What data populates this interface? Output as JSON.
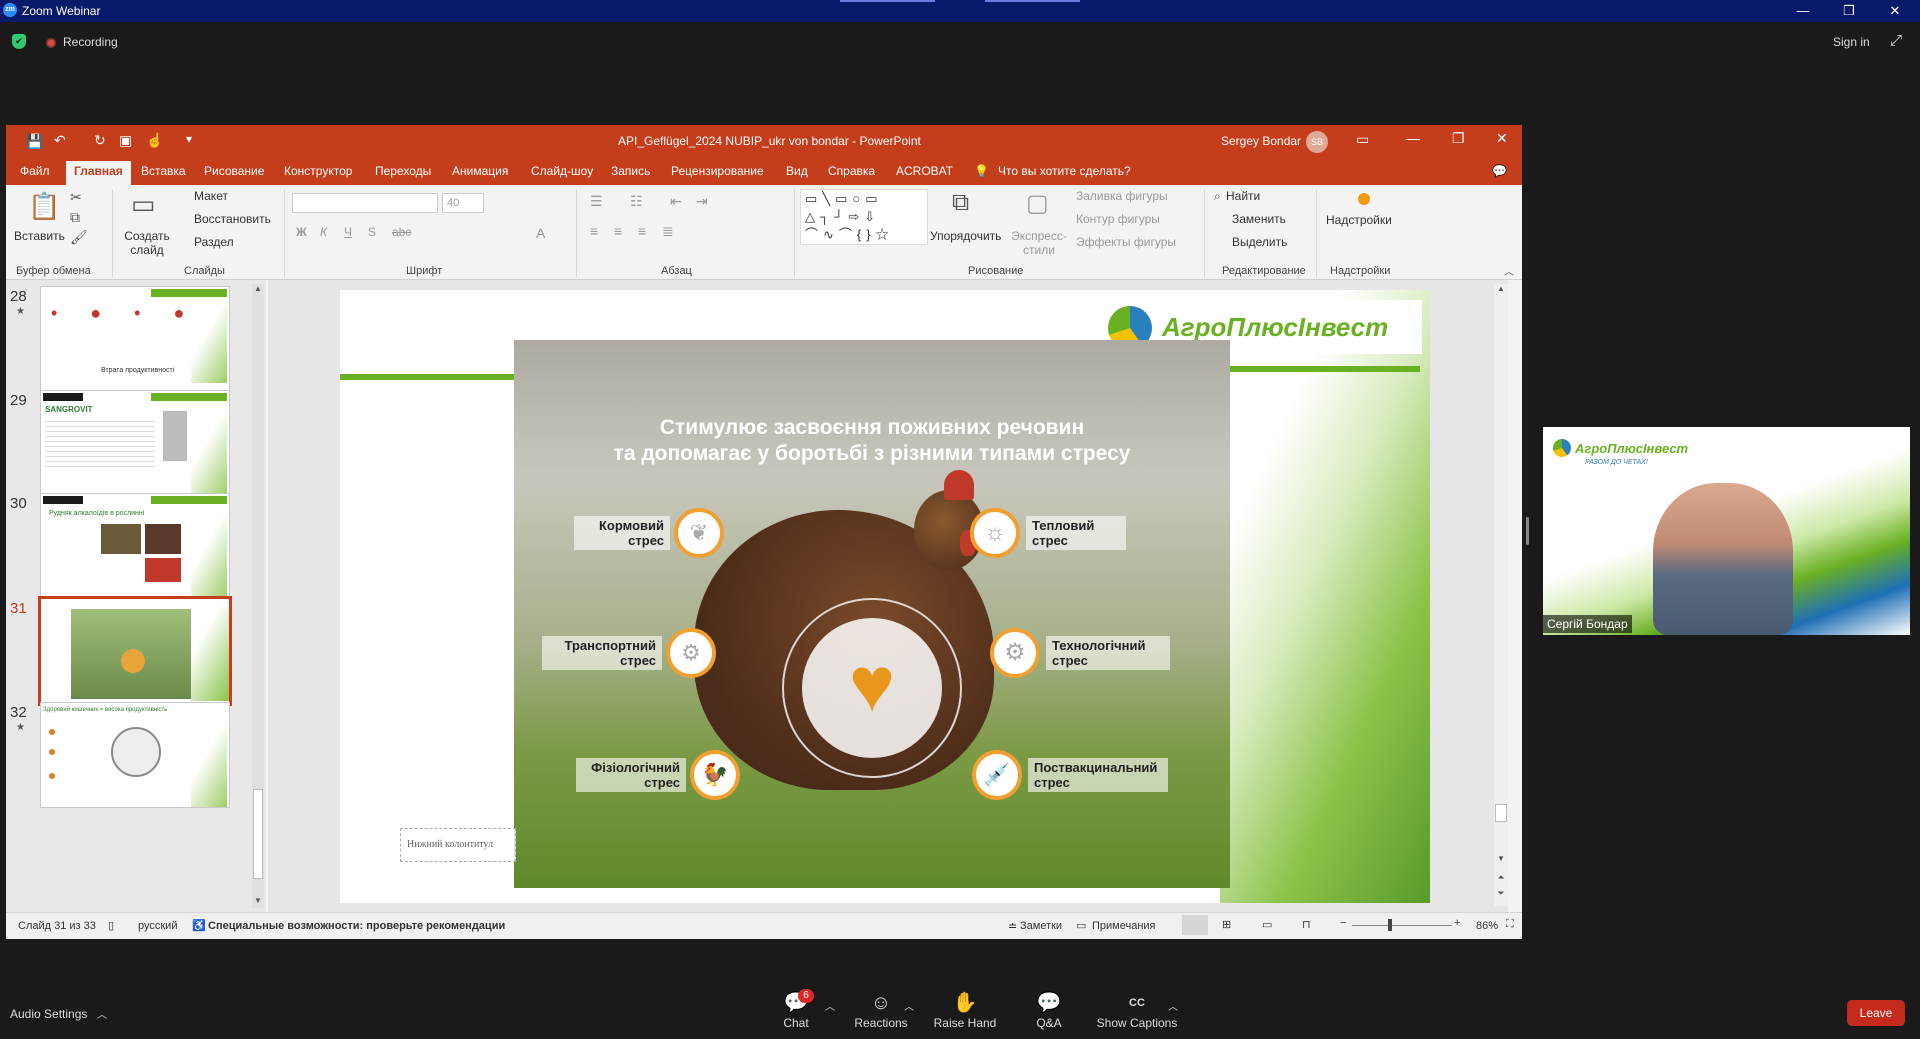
{
  "zoom": {
    "window_title": "Zoom Webinar",
    "logo_text": "zm",
    "recording_label": "Recording",
    "sign_in": "Sign in",
    "bottom": {
      "audio_settings": "Audio Settings",
      "chat": "Chat",
      "chat_badge": "6",
      "reactions": "Reactions",
      "raise_hand": "Raise Hand",
      "qa": "Q&A",
      "show_captions": "Show Captions",
      "leave": "Leave"
    },
    "video": {
      "participant_name": "Сергій Бондар",
      "brand": "АгроПлюсІнвест",
      "tagline": "РАЗОМ ДО ЧЕТАХ!"
    }
  },
  "ppt": {
    "title": "API_Geflügel_2024 NUBIP_ukr von bondar  -  PowerPoint",
    "user": "Sergey Bondar",
    "user_initials": "SB",
    "menu": [
      "Файл",
      "Главная",
      "Вставка",
      "Рисование",
      "Конструктор",
      "Переходы",
      "Анимация",
      "Слайд-шоу",
      "Запись",
      "Рецензирование",
      "Вид",
      "Справка",
      "ACROBAT"
    ],
    "tell_me": "Что вы хотите сделать?",
    "ribbon": {
      "paste": "Вставить",
      "clipboard": "Буфер обмена",
      "new_slide": "Создать слайд",
      "layout": "Макет",
      "reset": "Восстановить",
      "section": "Раздел",
      "slides": "Слайды",
      "font_size": "40",
      "font": "Шрифт",
      "paragraph": "Абзац",
      "arrange": "Упорядочить",
      "quick_styles": "Экспресс-стили",
      "shape_fill": "Заливка фигуры",
      "shape_outline": "Контур фигуры",
      "shape_effects": "Эффекты фигуры",
      "drawing": "Рисование",
      "find": "Найти",
      "replace": "Заменить",
      "select": "Выделить",
      "editing": "Редактирование",
      "addins": "Надстройки",
      "addins_group": "Надстройки"
    },
    "thumbnails": [
      {
        "num": "28",
        "caption": "Втрата продуктивності"
      },
      {
        "num": "29",
        "caption": "SANGROVIT"
      },
      {
        "num": "30",
        "caption": "Рудняк алкалоїдів в рослинні"
      },
      {
        "num": "31",
        "caption": ""
      },
      {
        "num": "32",
        "caption": "Здоровий кишечник = висока продуктивність"
      }
    ],
    "slide": {
      "logo": "АгроПлюсІнвест",
      "headline_1": "Стимулює засвоєння поживних речовин",
      "headline_2": "та допомагає у боротьбі з різними типами стресу",
      "stress_feed": "Кормовий стрес",
      "stress_heat": "Тепловий стрес",
      "stress_transport": "Транспортний стрес",
      "stress_tech": "Технологічний стрес",
      "stress_physio": "Фізіологічний стрес",
      "stress_vaccine": "Поствакцинальний стрес",
      "footer": "Нижний колонтитул"
    },
    "status": {
      "slide_count": "Слайд 31 из 33",
      "language": "русский",
      "accessibility": "Специальные возможности: проверьте рекомендации",
      "notes": "Заметки",
      "comments": "Примечания",
      "zoom": "86%"
    }
  },
  "colors": {
    "ppt_accent": "#c43e1c",
    "zoom_title": "#0a1a6b",
    "slide_green": "#6ab023",
    "leave_red": "#c42b1c"
  }
}
